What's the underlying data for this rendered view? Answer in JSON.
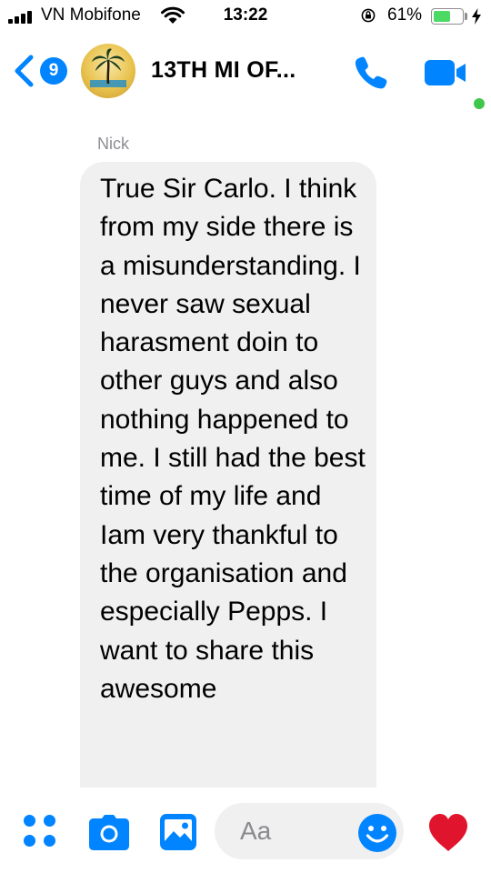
{
  "status_bar": {
    "carrier": "VN Mobifone",
    "time": "13:22",
    "battery_percent": "61%",
    "battery_level": 0.61,
    "icons": [
      "signal-icon",
      "wifi-icon",
      "orientation-lock-icon",
      "battery-icon",
      "charging-icon"
    ]
  },
  "header": {
    "back_badge_count": "9",
    "chat_title": "13TH MI OF...",
    "icons": [
      "back-chevron-icon",
      "avatar",
      "phone-icon",
      "video-camera-icon",
      "active-status-dot"
    ]
  },
  "conversation": {
    "messages": [
      {
        "sender": "Nick",
        "text": "True Sir Carlo. I think from my side there is a misunderstanding. I never saw sexual harasment doin to other guys and also nothing happened to me. I still had the best time of my life and Iam very thankful to the organisation and especially Pepps. I want to share this awesome"
      }
    ]
  },
  "composer": {
    "placeholder": "Aa",
    "icons": [
      "more-options-icon",
      "camera-icon",
      "gallery-icon",
      "emoji-icon",
      "heart-icon"
    ]
  },
  "colors": {
    "accent": "#0084ff",
    "bubble": "#f0f0f0",
    "sender_name": "#8e8e93",
    "active_dot": "#3fc74b",
    "heart": "#e0142c",
    "battery_fill": "#4cd964"
  }
}
